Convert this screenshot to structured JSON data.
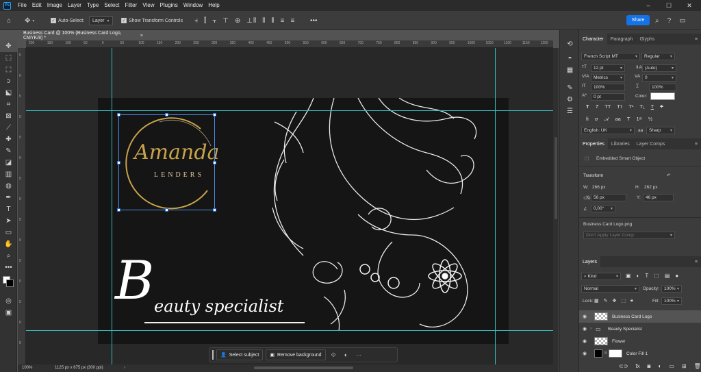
{
  "menubar": {
    "logo": "Ps",
    "items": [
      "File",
      "Edit",
      "Image",
      "Layer",
      "Type",
      "Select",
      "Filter",
      "View",
      "Plugins",
      "Window",
      "Help"
    ],
    "window_controls": [
      "–",
      "☐",
      "✕"
    ]
  },
  "options": {
    "auto_select_label": "Auto-Select:",
    "auto_select_value": "Layer",
    "show_transform_label": "Show Transform Controls",
    "share_label": "Share"
  },
  "doc_tab": {
    "title": "Business Card @ 100% (Business Card Logo, CMYK/8) *",
    "close": "×"
  },
  "ruler": {
    "top": [
      "200",
      "150",
      "100",
      "50",
      "0",
      "50",
      "100",
      "150",
      "200",
      "250",
      "300",
      "350",
      "400",
      "450",
      "500",
      "550",
      "600",
      "650",
      "700",
      "750",
      "800",
      "850",
      "900",
      "950",
      "1000",
      "1050",
      "1100",
      "1150",
      "1200",
      "1250"
    ],
    "left": [
      "5",
      "0",
      "5",
      "0",
      "5",
      "0",
      "5",
      "0",
      "5",
      "0",
      "5",
      "0",
      "5",
      "0",
      "5"
    ]
  },
  "artwork": {
    "logo_name_script": "Amanda",
    "logo_name_caps": "LENDERS",
    "headline_initial": "B",
    "headline_rest": "eauty specialist",
    "colors": {
      "gold": "#c8a24a",
      "card_bg": "#151515",
      "guide": "#35c0c0",
      "selection": "#4a8ee8"
    }
  },
  "taskbar": {
    "select_subject": "Select subject",
    "remove_background": "Remove background",
    "more": "···"
  },
  "status": {
    "zoom": "100%",
    "doc_info": "1125 px x 675 px (300 ppi)"
  },
  "character": {
    "tabs": [
      "Character",
      "Paragraph",
      "Glyphs"
    ],
    "font_family": "French Script MT",
    "font_style": "Regular",
    "font_size": "12 pt",
    "leading": "(Auto)",
    "kerning": "Metrics",
    "tracking": "0",
    "vertical_scale": "100%",
    "horizontal_scale": "100%",
    "baseline_shift": "0 pt",
    "color_label": "Color:",
    "style_buttons": [
      "T",
      "T",
      "TT",
      "Tт",
      "T¹",
      "T₁",
      "T",
      "T"
    ],
    "language": "English: UK",
    "aa_label": "aa",
    "antialias": "Sharp"
  },
  "properties": {
    "tabs": [
      "Properties",
      "Libraries",
      "Layer Comps"
    ],
    "object_type": "Embedded Smart Object",
    "transform_title": "Transform",
    "w_label": "W:",
    "w_value": "266 px",
    "h_label": "H:",
    "h_value": "262 px",
    "x_label": "X:",
    "x_value": "56 px",
    "y_label": "Y:",
    "y_value": "46 px",
    "angle": "0,00°",
    "filename": "Business Card Logo.png",
    "layer_comp": "Don't Apply Layer Comp"
  },
  "layers": {
    "title": "Layers",
    "kind": "Kind",
    "blend_mode": "Normal",
    "opacity_label": "Opacity:",
    "opacity": "100%",
    "lock_label": "Lock:",
    "fill_label": "Fill:",
    "fill": "100%",
    "items": [
      {
        "name": "Business Card Logo"
      },
      {
        "name": "Beauty Specialist"
      },
      {
        "name": "Flower"
      },
      {
        "name": "Color Fill 1"
      }
    ]
  }
}
